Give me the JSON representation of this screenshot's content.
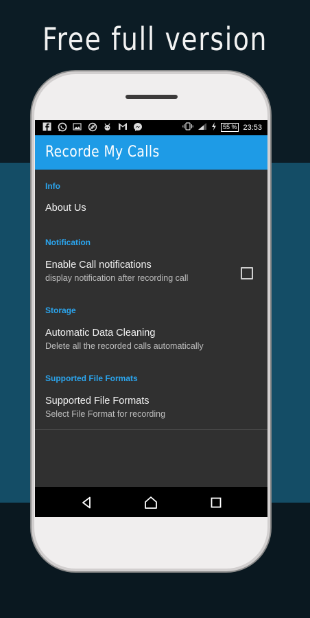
{
  "promo": {
    "headline": "Free full version"
  },
  "status_bar": {
    "left_icons": [
      "facebook-icon",
      "whatsapp-icon",
      "image-icon",
      "no-data-icon",
      "bug-icon",
      "gmail-icon",
      "messenger-icon"
    ],
    "battery": "55 %",
    "time": "23:53"
  },
  "app_bar": {
    "title": "Recorde My Calls"
  },
  "sections": {
    "info": {
      "header": "Info",
      "items": [
        {
          "title": "About Us"
        }
      ]
    },
    "notification": {
      "header": "Notification",
      "items": [
        {
          "title": "Enable Call notifications",
          "subtitle": "display notification after recording call",
          "checked": false
        }
      ]
    },
    "storage": {
      "header": "Storage",
      "items": [
        {
          "title": "Automatic Data Cleaning",
          "subtitle": "Delete all the recorded calls automatically"
        }
      ]
    },
    "formats": {
      "header": "Supported File Formats",
      "items": [
        {
          "title": "Supported File Formats",
          "subtitle": "Select File Format for recording"
        }
      ]
    }
  },
  "nav_bar": {
    "buttons": [
      "back-icon",
      "home-icon",
      "recents-icon"
    ]
  },
  "colors": {
    "accent": "#1e9be6",
    "section_header": "#2ba5ee",
    "background": "#303030"
  }
}
